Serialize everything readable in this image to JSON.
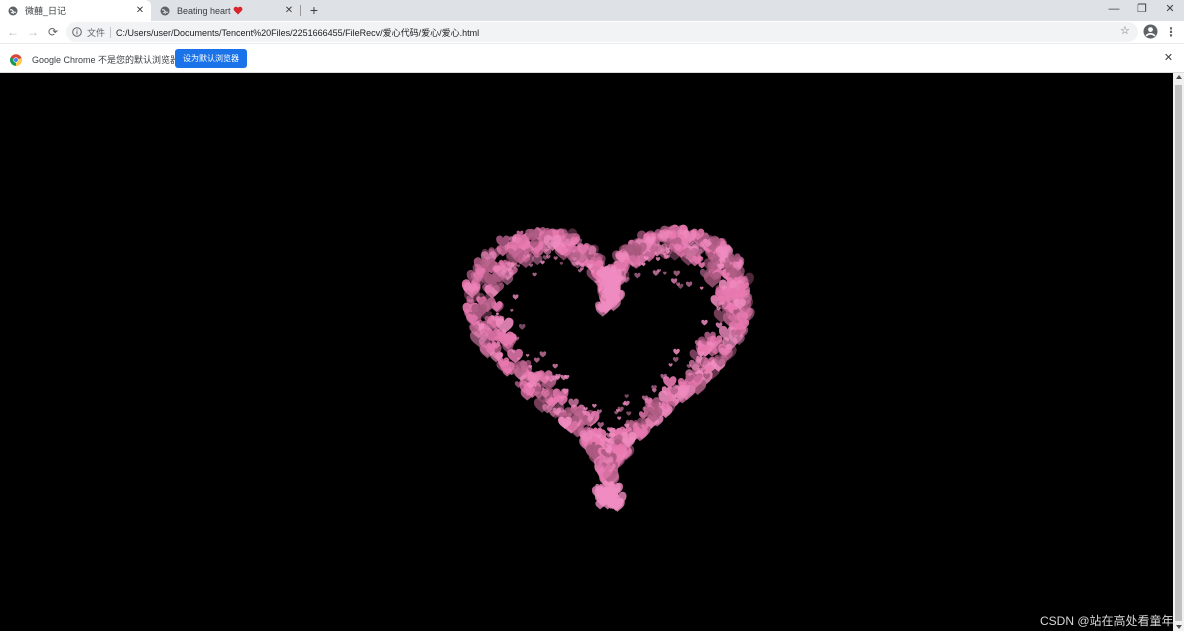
{
  "tabs": [
    {
      "title": "微囍_日记",
      "icon": "globe-icon",
      "active": true
    },
    {
      "title": "Beating heart",
      "icon": "globe-icon",
      "title_icon": "red-heart-icon",
      "active": false
    }
  ],
  "window_controls": {
    "minimize": "—",
    "restore": "❐",
    "close": "✕"
  },
  "toolbar": {
    "back": "←",
    "forward": "→",
    "reload": "⟳",
    "scheme_label": "文件",
    "url": "C:/Users/user/Documents/Tencent%20Files/2251666455/FileRecv/爱心代码/爱心/爱心.html",
    "bookmark": "☆",
    "menu": "⋮"
  },
  "infobar": {
    "message": "Google Chrome 不是您的默认浏览器",
    "button_label": "设为默认浏览器",
    "close": "✕"
  },
  "colors": {
    "heart_pink": "#e879b0",
    "heart_light": "#f08cc0",
    "heart_dark": "#a8587e",
    "background": "#000000",
    "infobar_button": "#1a73e8"
  },
  "watermark": "CSDN @站在高处看童年"
}
